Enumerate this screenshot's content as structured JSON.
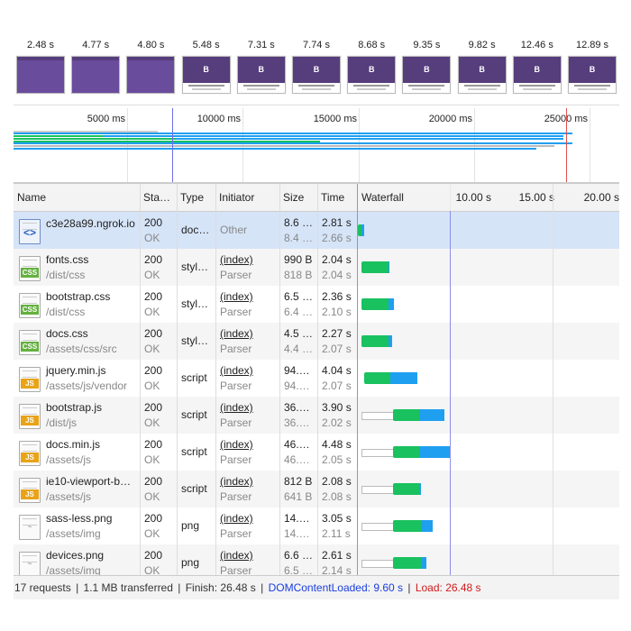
{
  "colors": {
    "green": "#19c15f",
    "blue": "#1f9ff0",
    "dcl_line": "#6e6ee8",
    "load_line": "#e05050"
  },
  "filmstrip": [
    {
      "time": "2.48 s",
      "state": "blank"
    },
    {
      "time": "4.77 s",
      "state": "blank"
    },
    {
      "time": "4.80 s",
      "state": "blank"
    },
    {
      "time": "5.48 s",
      "state": "loaded"
    },
    {
      "time": "7.31 s",
      "state": "loaded"
    },
    {
      "time": "7.74 s",
      "state": "loaded"
    },
    {
      "time": "8.68 s",
      "state": "loaded"
    },
    {
      "time": "9.35 s",
      "state": "loaded"
    },
    {
      "time": "9.82 s",
      "state": "loaded"
    },
    {
      "time": "12.46 s",
      "state": "loaded"
    },
    {
      "time": "12.89 s",
      "state": "loaded"
    }
  ],
  "overview": {
    "ticks": [
      "5000 ms",
      "10000 ms",
      "15000 ms",
      "20000 ms",
      "25000 ms"
    ]
  },
  "columns": {
    "name": "Name",
    "status": "Sta…",
    "type": "Type",
    "initiator": "Initiator",
    "size": "Size",
    "time": "Time",
    "waterfall": "Waterfall",
    "wf_ticks": [
      "10.00 s",
      "15.00 s",
      "20.00 s"
    ]
  },
  "requests": [
    {
      "icon": "doc",
      "name": "c3e28a99.ngrok.io",
      "path": "",
      "status": "200",
      "status_text": "OK",
      "type": "doc…",
      "initiator": "Other",
      "initiator_sub": "",
      "size": "8.6 …",
      "size_sub": "8.4 …",
      "time": "2.81 s",
      "time_sub": "2.66 s",
      "selected": true
    },
    {
      "icon": "css",
      "name": "fonts.css",
      "path": "/dist/css",
      "status": "200",
      "status_text": "OK",
      "type": "styl…",
      "initiator": "(index)",
      "initiator_sub": "Parser",
      "size": "990 B",
      "size_sub": "818 B",
      "time": "2.04 s",
      "time_sub": "2.04 s"
    },
    {
      "icon": "css",
      "name": "bootstrap.css",
      "path": "/dist/css",
      "status": "200",
      "status_text": "OK",
      "type": "styl…",
      "initiator": "(index)",
      "initiator_sub": "Parser",
      "size": "6.5 …",
      "size_sub": "6.4 …",
      "time": "2.36 s",
      "time_sub": "2.10 s"
    },
    {
      "icon": "css",
      "name": "docs.css",
      "path": "/assets/css/src",
      "status": "200",
      "status_text": "OK",
      "type": "styl…",
      "initiator": "(index)",
      "initiator_sub": "Parser",
      "size": "4.5 …",
      "size_sub": "4.4 …",
      "time": "2.27 s",
      "time_sub": "2.07 s"
    },
    {
      "icon": "js",
      "name": "jquery.min.js",
      "path": "/assets/js/vendor",
      "status": "200",
      "status_text": "OK",
      "type": "script",
      "initiator": "(index)",
      "initiator_sub": "Parser",
      "size": "94.…",
      "size_sub": "94.…",
      "time": "4.04 s",
      "time_sub": "2.07 s"
    },
    {
      "icon": "js",
      "name": "bootstrap.js",
      "path": "/dist/js",
      "status": "200",
      "status_text": "OK",
      "type": "script",
      "initiator": "(index)",
      "initiator_sub": "Parser",
      "size": "36.…",
      "size_sub": "36.…",
      "time": "3.90 s",
      "time_sub": "2.02 s"
    },
    {
      "icon": "js",
      "name": "docs.min.js",
      "path": "/assets/js",
      "status": "200",
      "status_text": "OK",
      "type": "script",
      "initiator": "(index)",
      "initiator_sub": "Parser",
      "size": "46.…",
      "size_sub": "46.…",
      "time": "4.48 s",
      "time_sub": "2.05 s"
    },
    {
      "icon": "js",
      "name": "ie10-viewport-b…",
      "path": "/assets/js",
      "status": "200",
      "status_text": "OK",
      "type": "script",
      "initiator": "(index)",
      "initiator_sub": "Parser",
      "size": "812 B",
      "size_sub": "641 B",
      "time": "2.08 s",
      "time_sub": "2.08 s"
    },
    {
      "icon": "img",
      "name": "sass-less.png",
      "path": "/assets/img",
      "status": "200",
      "status_text": "OK",
      "type": "png",
      "initiator": "(index)",
      "initiator_sub": "Parser",
      "size": "14.…",
      "size_sub": "14.…",
      "time": "3.05 s",
      "time_sub": "2.11 s"
    },
    {
      "icon": "img",
      "name": "devices.png",
      "path": "/assets/img",
      "status": "200",
      "status_text": "OK",
      "type": "png",
      "initiator": "(index)",
      "initiator_sub": "Parser",
      "size": "6.6 …",
      "size_sub": "6.5 …",
      "time": "2.61 s",
      "time_sub": "2.14 s"
    }
  ],
  "footer": {
    "requests": "17 requests",
    "transferred": "1.1 MB transferred",
    "finish": "Finish: 26.48 s",
    "dcl": "DOMContentLoaded: 9.60 s",
    "load": "Load: 26.48 s",
    "sep": "|"
  }
}
